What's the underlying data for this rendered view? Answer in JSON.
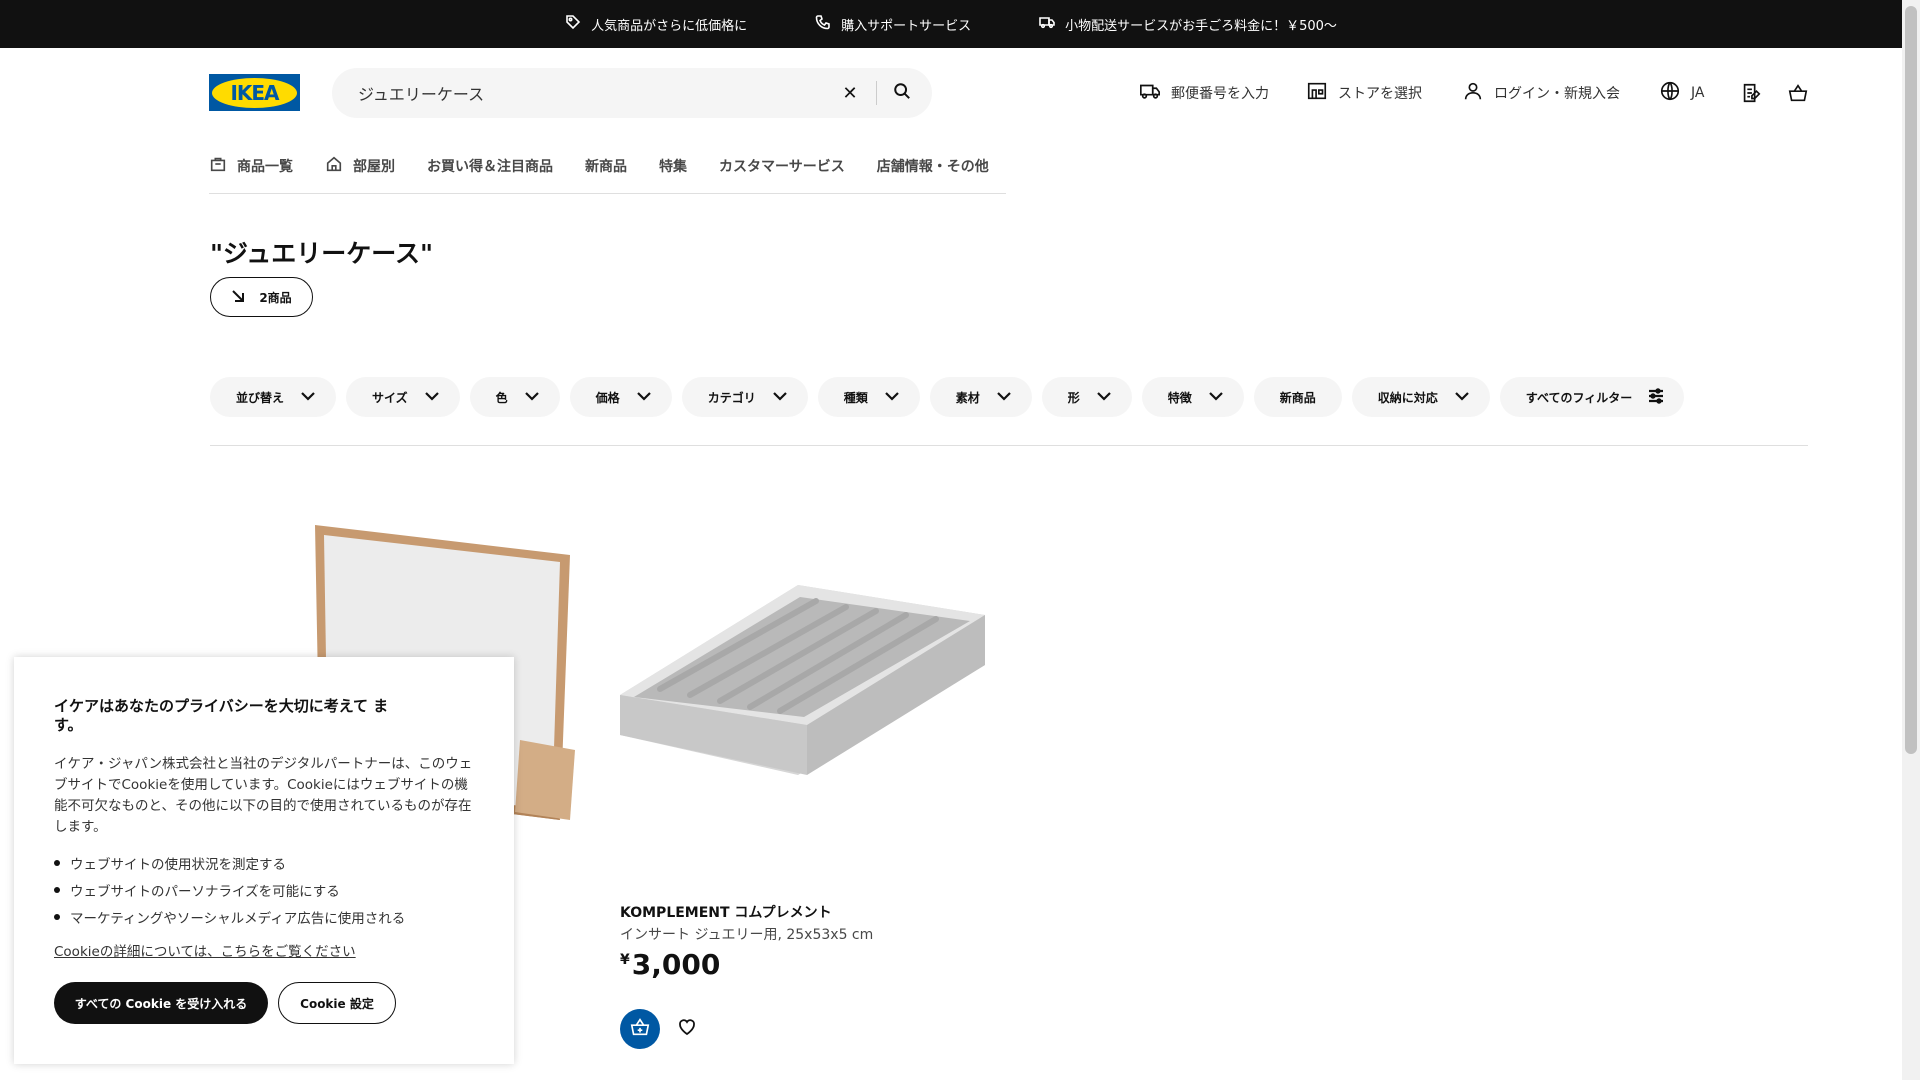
{
  "topbar": {
    "items": [
      {
        "icon": "tag-icon",
        "label": "人気商品がさらに低価格に"
      },
      {
        "icon": "phone-icon",
        "label": "購入サポートサービス"
      },
      {
        "icon": "truck-icon",
        "label": "小物配送サービスがお手ごろ料金に！￥500〜"
      }
    ]
  },
  "header": {
    "logo_text": "IKEA",
    "search": {
      "value": "ジュエリーケース",
      "clear_icon": "close-icon",
      "submit_icon": "search-icon"
    },
    "postal_label": "郵便番号を入力",
    "store_label": "ストアを選択",
    "login_label": "ログイン・新規入会",
    "language_label": "JA"
  },
  "nav": {
    "items": [
      {
        "label": "商品一覧",
        "icon": "bag-icon"
      },
      {
        "label": "部屋別",
        "icon": "home-icon"
      },
      {
        "label": "お買い得＆注目商品"
      },
      {
        "label": "新商品"
      },
      {
        "label": "特集"
      },
      {
        "label": "カスタマーサービス"
      },
      {
        "label": "店舗情報・その他"
      }
    ]
  },
  "results": {
    "title": "\"ジュエリーケース\"",
    "count_label": "2商品"
  },
  "filters": [
    "並び替え",
    "サイズ",
    "色",
    "価格",
    "カテゴリ",
    "種類",
    "素材",
    "形",
    "特徴",
    "新商品",
    "収納に対応",
    "すべてのフィルター"
  ],
  "product": {
    "name": "KOMPLEMENT コムプレメント",
    "description": "インサート ジュエリー用, 25x53x5 cm",
    "currency": "¥",
    "price": "3,000"
  },
  "cookie": {
    "title": "イケアはあなたのプライバシーを大切に考えて ます。",
    "body": "イケア・ジャパン株式会社と当社のデジタルパートナーは、このウェブサイトでCookieを使用しています。Cookieにはウェブサイトの機能不可欠なものと、その他に以下の目的で使用されているものが存在します。",
    "bullets": [
      "ウェブサイトの使用状況を測定する",
      "ウェブサイトのパーソナライズを可能にする",
      "マーケティングやソーシャルメディア広告に使用される"
    ],
    "more_link": "Cookieの詳細については、こちらをご覧ください",
    "accept_label": "すべての Cookie を受け入れる",
    "settings_label": "Cookie 設定"
  },
  "colors": {
    "brand_blue": "#0058a3",
    "brand_yellow": "#ffdb00",
    "topbar_bg": "#111111",
    "chip_bg": "#f5f5f5"
  }
}
